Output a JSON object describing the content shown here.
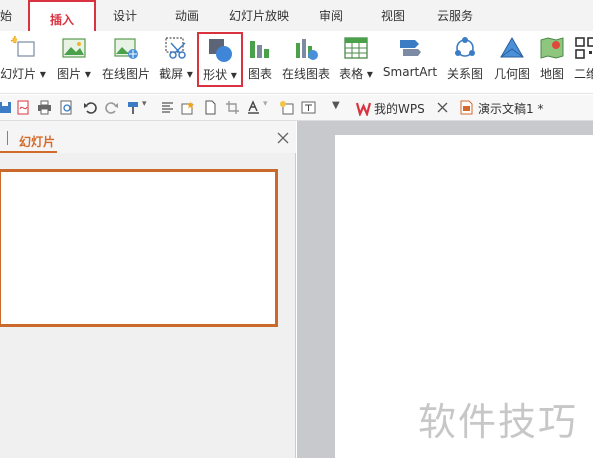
{
  "tabs": [
    {
      "label": "始",
      "active": false
    },
    {
      "label": "插入",
      "active": true
    },
    {
      "label": "设计",
      "active": false
    },
    {
      "label": "动画",
      "active": false
    },
    {
      "label": "幻灯片放映",
      "active": false
    },
    {
      "label": "审阅",
      "active": false
    },
    {
      "label": "视图",
      "active": false
    },
    {
      "label": "云服务",
      "active": false
    }
  ],
  "ribbon": [
    {
      "label": "幻灯片",
      "icon": "new-slide-icon",
      "dropdown": true
    },
    {
      "label": "图片",
      "icon": "picture-icon",
      "dropdown": true
    },
    {
      "label": "在线图片",
      "icon": "online-picture-icon",
      "dropdown": false
    },
    {
      "label": "截屏",
      "icon": "screenshot-icon",
      "dropdown": true
    },
    {
      "label": "形状",
      "icon": "shapes-icon",
      "dropdown": true,
      "highlighted": true
    },
    {
      "label": "图表",
      "icon": "chart-icon",
      "dropdown": false
    },
    {
      "label": "在线图表",
      "icon": "online-chart-icon",
      "dropdown": false
    },
    {
      "label": "表格",
      "icon": "table-icon",
      "dropdown": true
    },
    {
      "label": "SmartArt",
      "icon": "smartart-icon",
      "dropdown": false
    },
    {
      "label": "关系图",
      "icon": "relationship-icon",
      "dropdown": false
    },
    {
      "label": "几何图",
      "icon": "geometry-icon",
      "dropdown": false
    },
    {
      "label": "地图",
      "icon": "map-icon",
      "dropdown": false
    },
    {
      "label": "二维",
      "icon": "qrcode-icon",
      "dropdown": false
    }
  ],
  "doc_tabs": [
    {
      "label": "我的WPS",
      "icon": "wps-logo-icon",
      "closable": true
    },
    {
      "label": "演示文稿1 *",
      "icon": "presentation-doc-icon",
      "closable": false
    }
  ],
  "pane": {
    "title": "幻灯片"
  },
  "watermark": "软件技巧",
  "colors": {
    "accent": "#d9333f",
    "pane_accent": "#d46a2a",
    "canvas_bg": "#c8c9cc"
  }
}
